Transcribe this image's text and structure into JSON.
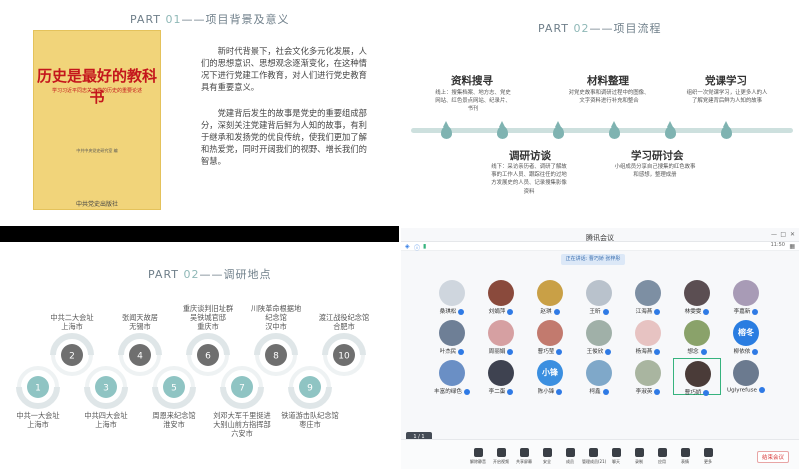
{
  "slide1": {
    "part_label": "PART",
    "part_num": "01",
    "title": "——项目背景及意义",
    "book": {
      "title": "历史是最好的教科书",
      "subtitle": "学习习近平同志关于党的历史的重要论述",
      "publisher_small": "中共中央党史研究室 编",
      "press": "中共党史出版社"
    },
    "paragraph1": "新时代背景下，社会文化多元化发展，人们的思想意识、思想观念逐渐变化，在这种情况下进行党建工作教育，对人们进行党史教育具有重要意义。",
    "paragraph2": "党建背后发生的故事是党史的重要组成部分，深刻关注党建背后鲜为人知的故事，有利于继承和发扬党的优良传统，使我们更加了解和热爱党，同时开阔我们的视野、增长我们的智慧。"
  },
  "slide2": {
    "part_label": "PART",
    "part_num": "02",
    "title": "——项目流程",
    "steps": [
      {
        "title": "资料搜寻",
        "desc": "线上：搜集档案、地方志、党史网站、红色景点网站、纪录片、书刊"
      },
      {
        "title": "调研访谈",
        "desc": "线下：采访亲历者、调研了解故事的工作人员、跟踪往任的过地方发展史的人员、记录搜集影像资料"
      },
      {
        "title": "材料整理",
        "desc": "对党史故事和调研过程中的图像、文字资料进行补充和整合"
      },
      {
        "title": "学习研讨会",
        "desc": "小组成员分享自己搜集的红色故事和感想，整理成册"
      },
      {
        "title": "党课学习",
        "desc": "组织一次党课学习，让更多人的人了解党建背后鲜为人知的故事"
      }
    ]
  },
  "slide3": {
    "part_label": "PART",
    "part_num": "02",
    "title": "——调研地点",
    "nodes": [
      {
        "num": "1",
        "place": "中共一大会址\n上海市"
      },
      {
        "num": "2",
        "place": "中共二大会址\n上海市"
      },
      {
        "num": "3",
        "place": "中共四大会址\n上海市"
      },
      {
        "num": "4",
        "place": "张闻天故居\n无锡市"
      },
      {
        "num": "5",
        "place": "周恩来纪念馆\n淮安市"
      },
      {
        "num": "6",
        "place": "重庆谈判旧址群\n吴铁城官邸\n重庆市"
      },
      {
        "num": "7",
        "place": "刘邓大军千里挺进\n大别山前方指挥部\n六安市"
      },
      {
        "num": "8",
        "place": "川陕革命根据地\n纪念馆\n汉中市"
      },
      {
        "num": "9",
        "place": "铁道游击队纪念馆\n枣庄市"
      },
      {
        "num": "10",
        "place": "渡江战役纪念馆\n合肥市"
      }
    ]
  },
  "meeting": {
    "window_title": "腾讯会议",
    "clock": "11:50",
    "banner": "正在讲话: 曹巧娇 张梓彤",
    "participants": [
      {
        "name": "桑琪松",
        "color": "#cfd6de"
      },
      {
        "name": "刘娟萍",
        "color": "#8a4a3c"
      },
      {
        "name": "赵琪",
        "color": "#c9a046"
      },
      {
        "name": "王昕",
        "color": "#b9c2cc"
      },
      {
        "name": "江海燕",
        "color": "#7d8fa3"
      },
      {
        "name": "林雯雯",
        "color": "#5b4e52"
      },
      {
        "name": "李嘉新",
        "color": "#a89bb6"
      },
      {
        "name": "叶杰民",
        "color": "#6e7f96"
      },
      {
        "name": "周丽娟",
        "color": "#d6a0a2"
      },
      {
        "name": "曹巧莹",
        "color": "#c27a6e"
      },
      {
        "name": "王俊欣",
        "color": "#a0b0a8"
      },
      {
        "name": "杨海燕",
        "color": "#e7c3c2"
      },
      {
        "name": "想念",
        "color": "#8aa26a"
      },
      {
        "name": "柳依依",
        "color": "#2a7de1"
      },
      {
        "name": "丰富的绿色",
        "color": "#6a8fc5"
      },
      {
        "name": "李二蛋",
        "color": "#3e4250"
      },
      {
        "name": "陈小锋",
        "color": "#3b8fe0"
      },
      {
        "name": "柯鑫",
        "color": "#7fa8c9"
      },
      {
        "name": "李淑英",
        "color": "#a9b5a0"
      },
      {
        "name": "曹巧娇",
        "color": "#4a3b38"
      },
      {
        "name": "Uglyrefuse",
        "color": "#6b7a8f"
      }
    ],
    "special_text": {
      "柳依依": "榕冬",
      "陈小锋": "小锋"
    },
    "toolbar": [
      "解除静音",
      "开启视频",
      "共享屏幕",
      "安全",
      "成员",
      "管理成员(21)",
      "聊天",
      "录制",
      "应用",
      "表情",
      "更多"
    ],
    "leave": "结束会议",
    "pager": "1 / 1"
  }
}
